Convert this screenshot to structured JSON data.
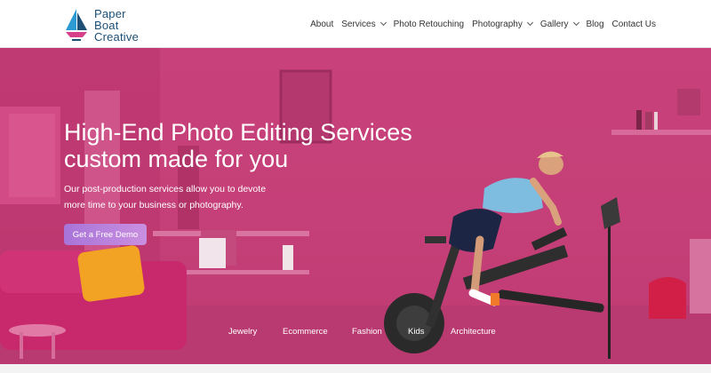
{
  "brand": {
    "name_line1": "Paper",
    "name_line2": "Boat",
    "name_line3": "Creative",
    "logo_icon": "paper-boat-icon",
    "colors": {
      "navy": "#1d4f74",
      "teal": "#2d9bd3",
      "pink": "#d6418a"
    }
  },
  "nav": {
    "items": [
      {
        "label": "About",
        "dropdown": false
      },
      {
        "label": "Services",
        "dropdown": true
      },
      {
        "label": "Photo Retouching",
        "dropdown": false
      },
      {
        "label": "Photography",
        "dropdown": true
      },
      {
        "label": "Gallery",
        "dropdown": true
      },
      {
        "label": "Blog",
        "dropdown": false
      },
      {
        "label": "Contact Us",
        "dropdown": false
      }
    ]
  },
  "hero": {
    "title_line1": "High-End Photo Editing Services",
    "title_line2": "custom made for you",
    "subtitle_line1": "Our post-production services allow you to devote",
    "subtitle_line2": "more time to your business or photography.",
    "cta_label": "Get a Free Demo",
    "background_color": "#c53f78",
    "cta_color": "#b47cdc"
  },
  "categories": [
    "Jewelry",
    "Ecommerce",
    "Fashion",
    "Kids",
    "Architecture"
  ]
}
